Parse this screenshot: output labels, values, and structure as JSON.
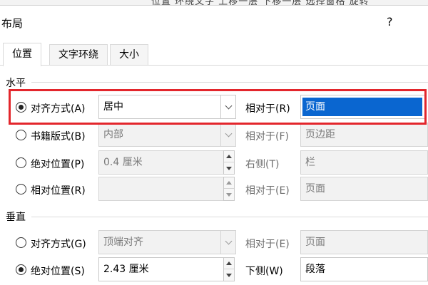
{
  "background_ribbon": {
    "text": "位置  环绕文字  上移一层  下移一层  选择窗格  旋转"
  },
  "dialog": {
    "title": "布局",
    "help": "?"
  },
  "tabs": [
    {
      "label": "位置",
      "active": true
    },
    {
      "label": "文字环绕",
      "active": false
    },
    {
      "label": "大小",
      "active": false
    }
  ],
  "horizontal": {
    "label": "水平",
    "alignment": {
      "label": "对齐方式(A)",
      "value": "居中",
      "relative_label": "相对于(R)",
      "relative_value": "页面",
      "checked": true
    },
    "book_layout": {
      "label": "书籍版式(B)",
      "value": "内部",
      "relative_label": "相对于(F)",
      "relative_value": "页边距",
      "checked": false
    },
    "absolute": {
      "label": "绝对位置(P)",
      "value": "0.4 厘米",
      "relative_label": "右侧(T)",
      "relative_value": "栏",
      "checked": false
    },
    "relative": {
      "label": "相对位置(R)",
      "value": "",
      "relative_label": "相对于(E)",
      "relative_value": "页面",
      "checked": false
    }
  },
  "vertical": {
    "label": "垂直",
    "alignment": {
      "label": "对齐方式(G)",
      "value": "顶端对齐",
      "relative_label": "相对于(E)",
      "relative_value": "页面",
      "checked": false
    },
    "absolute": {
      "label": "绝对位置(S)",
      "value": "2.43 厘米",
      "relative_label": "下侧(W)",
      "relative_value": "段落",
      "checked": true
    }
  },
  "colors": {
    "highlight_border": "#e3262c",
    "selection": "#0a66d0"
  }
}
